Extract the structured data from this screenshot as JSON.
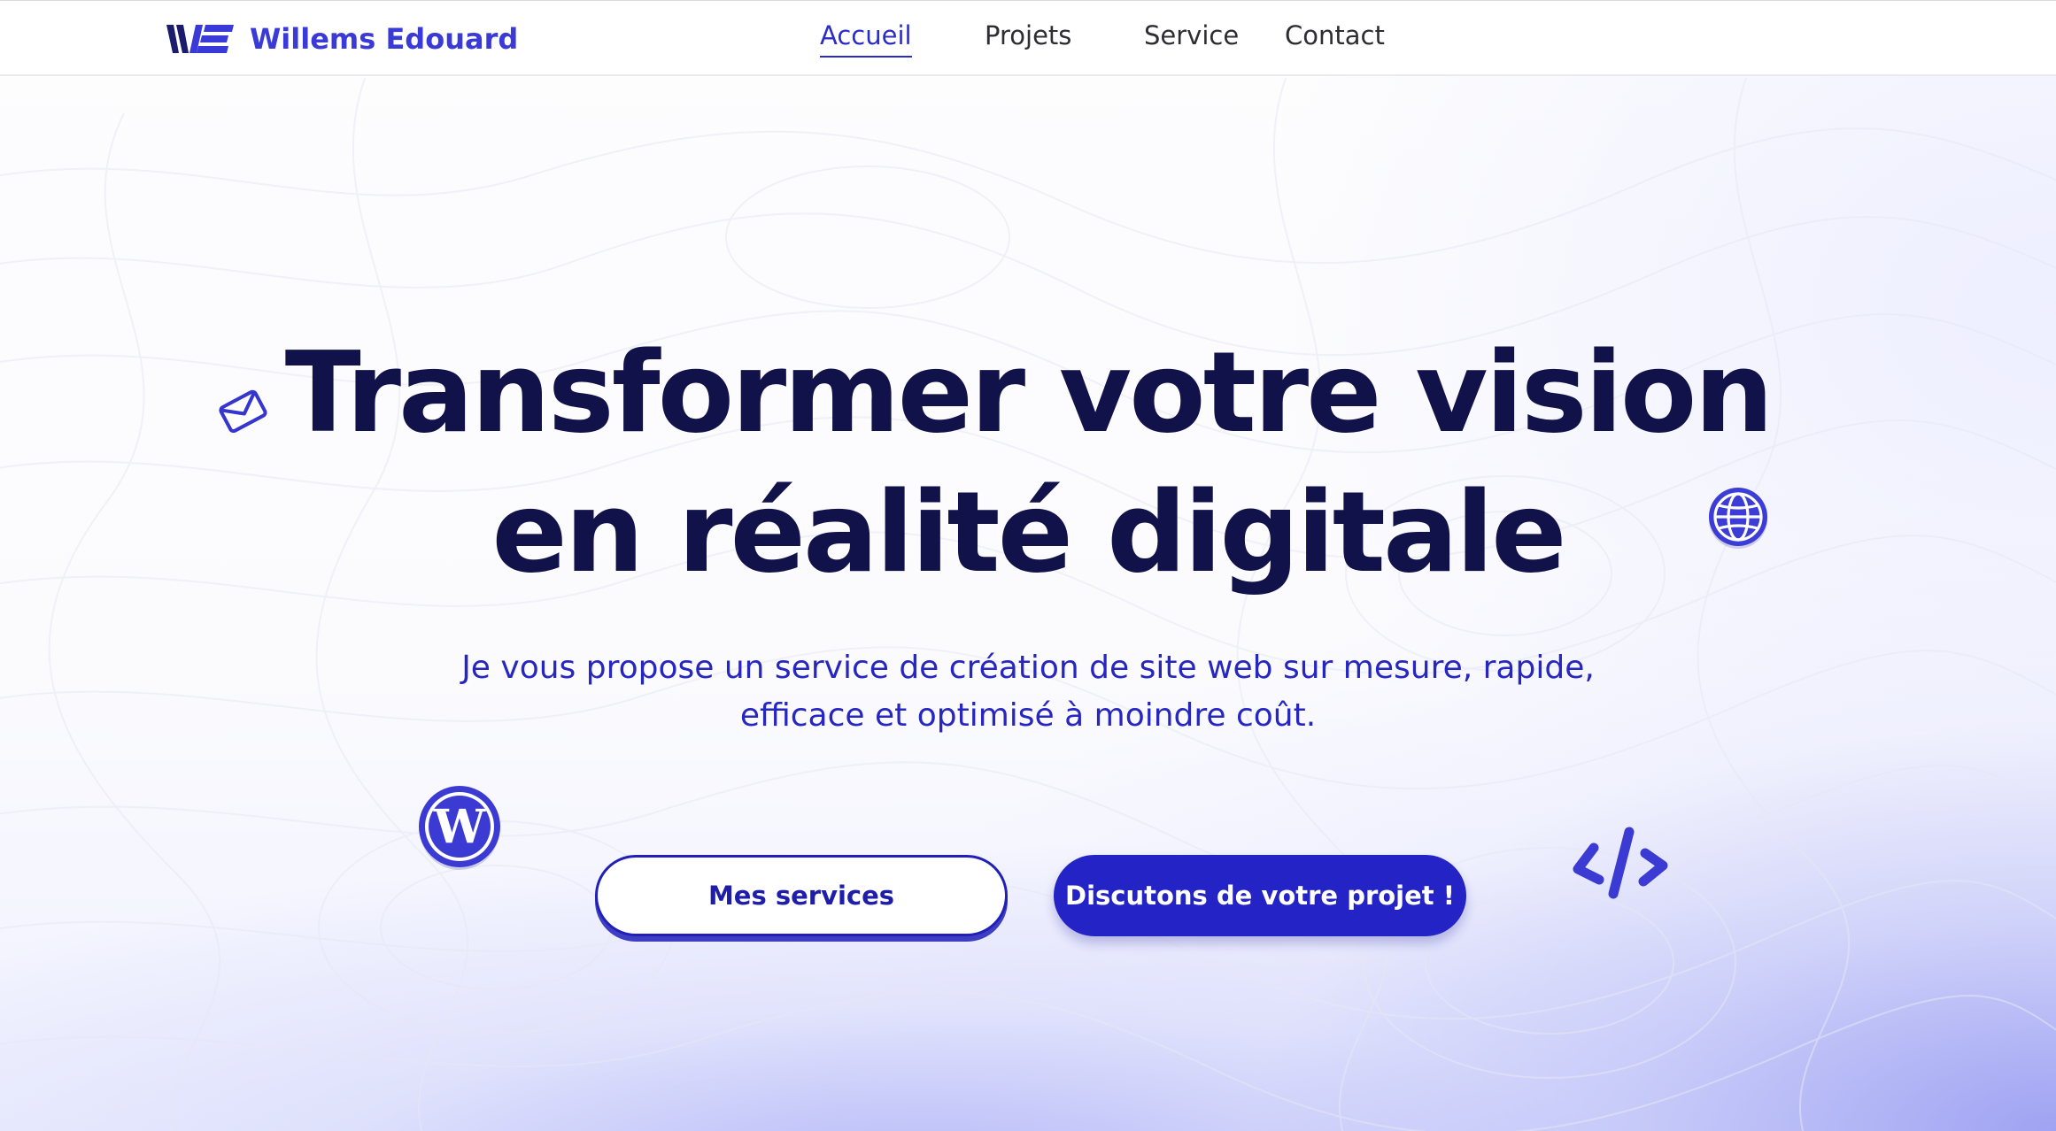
{
  "brand": {
    "name": "Willems Edouard",
    "logo_icon": "we-monogram-icon",
    "color": "#3a3ad8"
  },
  "nav": {
    "items": [
      {
        "label": "Accueil",
        "active": true
      },
      {
        "label": "Projets",
        "active": false
      },
      {
        "label": "Service",
        "active": false
      },
      {
        "label": "Contact",
        "active": false
      }
    ],
    "active_color": "#2c2cc6"
  },
  "hero": {
    "title_line1": "Transformer votre vision",
    "title_line2": "en réalité digitale",
    "subtitle_line1": "Je vous propose un service de création de site web sur mesure, rapide,",
    "subtitle_line2": "efficace et optimisé à moindre coût.",
    "title_color": "#12124a",
    "subtitle_color": "#2626c0"
  },
  "buttons": {
    "secondary_label": "Mes services",
    "primary_label": "Discutons de votre projet !",
    "accent_color": "#2424c6"
  },
  "decorations": {
    "icons": [
      "envelope-icon",
      "globe-icon",
      "wordpress-icon",
      "code-brackets-icon"
    ]
  }
}
